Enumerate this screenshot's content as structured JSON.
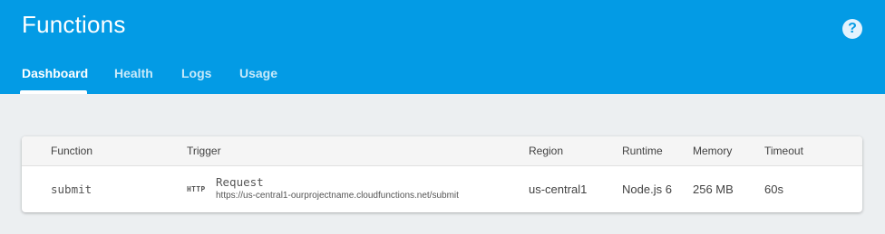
{
  "header": {
    "title": "Functions",
    "help_icon": "help-circle-icon"
  },
  "tabs": [
    {
      "label": "Dashboard",
      "active": true
    },
    {
      "label": "Health",
      "active": false
    },
    {
      "label": "Logs",
      "active": false
    },
    {
      "label": "Usage",
      "active": false
    }
  ],
  "table": {
    "columns": [
      "Function",
      "Trigger",
      "Region",
      "Runtime",
      "Memory",
      "Timeout"
    ],
    "rows": [
      {
        "function": "submit",
        "trigger_badge": "HTTP",
        "trigger_type": "Request",
        "trigger_url": "https://us-central1-ourprojectname.cloudfunctions.net/submit",
        "region": "us-central1",
        "runtime": "Node.js 6",
        "memory": "256 MB",
        "timeout": "60s"
      }
    ]
  },
  "colors": {
    "header_bg": "#039be5",
    "page_bg": "#eceff1",
    "card_bg": "#ffffff"
  }
}
